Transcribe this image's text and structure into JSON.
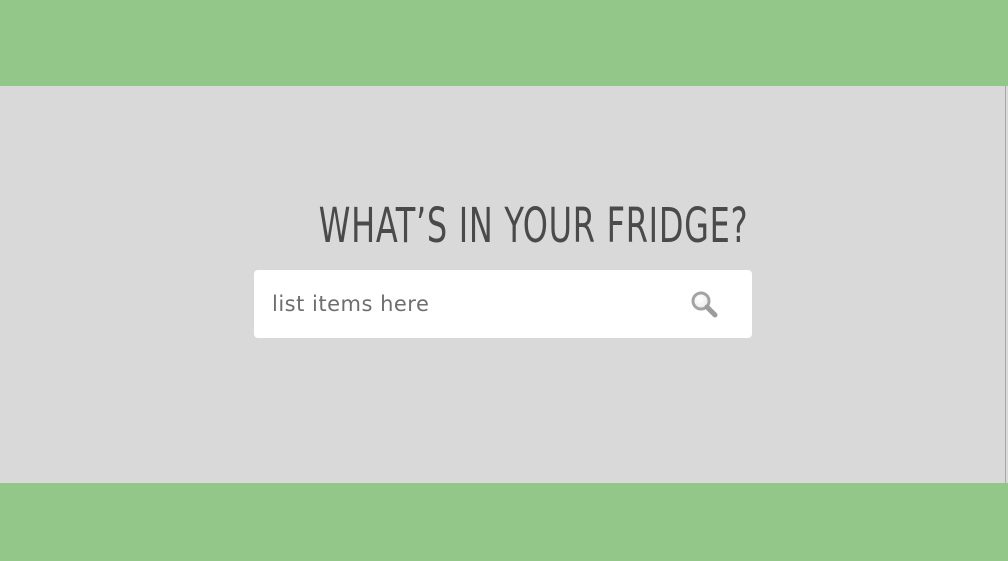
{
  "header": {
    "title": "WHAT’S IN YOUR FRIDGE?"
  },
  "search": {
    "placeholder": "list items here",
    "value": "",
    "button_icon": "search-icon"
  },
  "colors": {
    "band": "#92c789",
    "background": "#d9d9d9",
    "title_text": "#4a4a4a",
    "input_background": "#ffffff",
    "icon": "#a0a0a0"
  }
}
